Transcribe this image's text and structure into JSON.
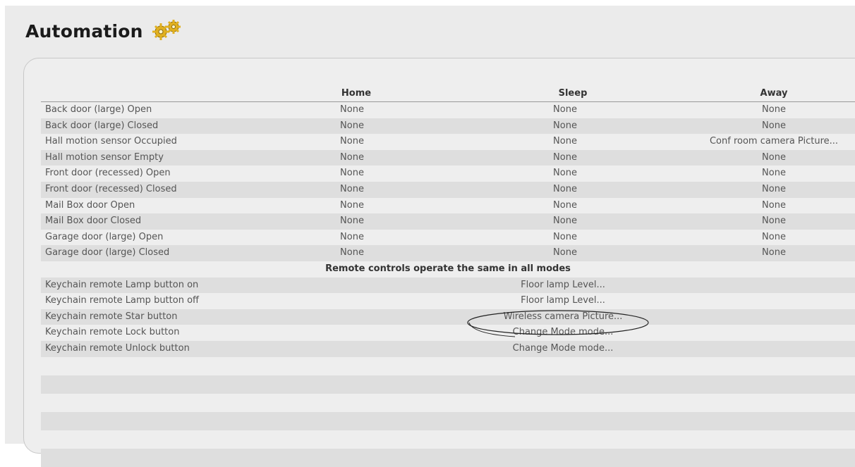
{
  "page": {
    "title": "Automation"
  },
  "columns": [
    "Home",
    "Sleep",
    "Away"
  ],
  "mode_rows": [
    {
      "label": "Back door (large) Open",
      "home": "None",
      "sleep": "None",
      "away": "None"
    },
    {
      "label": "Back door (large) Closed",
      "home": "None",
      "sleep": "None",
      "away": "None"
    },
    {
      "label": "Hall motion sensor Occupied",
      "home": "None",
      "sleep": "None",
      "away": "Conf room camera Picture..."
    },
    {
      "label": "Hall motion sensor Empty",
      "home": "None",
      "sleep": "None",
      "away": "None"
    },
    {
      "label": "Front door (recessed) Open",
      "home": "None",
      "sleep": "None",
      "away": "None"
    },
    {
      "label": "Front door (recessed) Closed",
      "home": "None",
      "sleep": "None",
      "away": "None"
    },
    {
      "label": "Mail Box door Open",
      "home": "None",
      "sleep": "None",
      "away": "None"
    },
    {
      "label": "Mail Box door Closed",
      "home": "None",
      "sleep": "None",
      "away": "None"
    },
    {
      "label": "Garage door (large) Open",
      "home": "None",
      "sleep": "None",
      "away": "None"
    },
    {
      "label": "Garage door (large) Closed",
      "home": "None",
      "sleep": "None",
      "away": "None"
    }
  ],
  "remote_section": {
    "heading": "Remote controls operate the same in all modes"
  },
  "remote_rows": [
    {
      "label": "Keychain remote Lamp button on",
      "action": "Floor lamp Level..."
    },
    {
      "label": "Keychain remote Lamp button off",
      "action": "Floor lamp Level..."
    },
    {
      "label": "Keychain remote Star button",
      "action": "Wireless camera Picture..."
    },
    {
      "label": "Keychain remote Lock button",
      "action": "Change Mode mode..."
    },
    {
      "label": "Keychain remote Unlock button",
      "action": "Change Mode mode..."
    }
  ],
  "icons": {
    "title_icon": "gears-icon",
    "annotation": "highlight-ellipse"
  },
  "colors": {
    "row_alt": "#dedede",
    "row_light": "#eeeeee",
    "gear_gold": "#e0b020"
  }
}
